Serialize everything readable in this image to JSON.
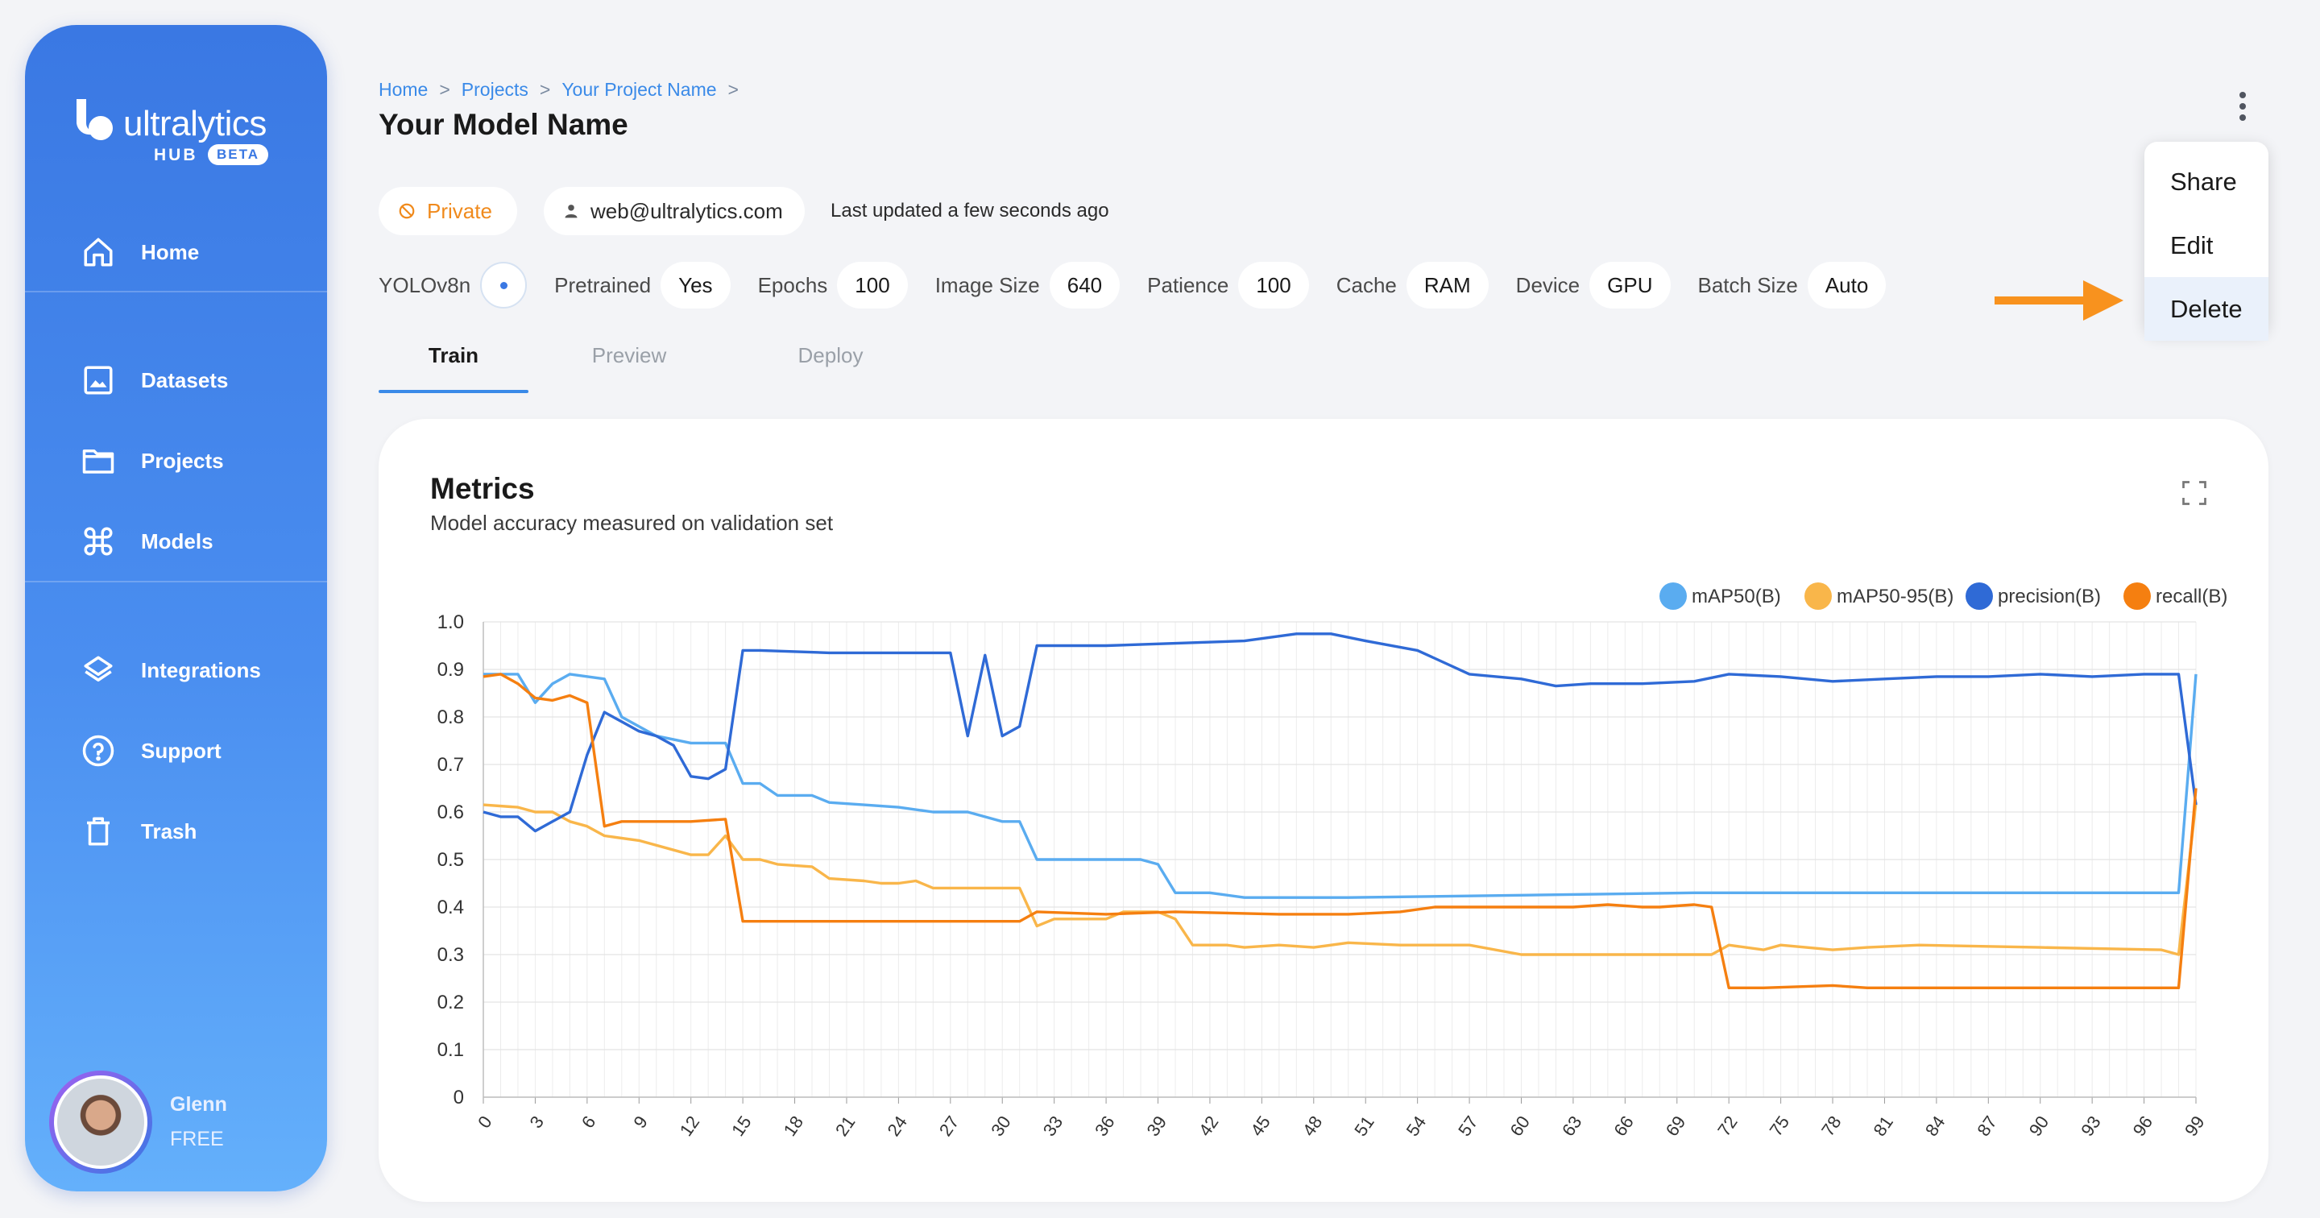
{
  "brand": {
    "name": "ultralytics",
    "hub": "HUB",
    "badge": "BETA"
  },
  "sidebar": {
    "items": [
      {
        "label": "Home",
        "icon": "home-icon"
      },
      {
        "label": "Datasets",
        "icon": "image-icon"
      },
      {
        "label": "Projects",
        "icon": "folder-icon"
      },
      {
        "label": "Models",
        "icon": "command-icon"
      },
      {
        "label": "Integrations",
        "icon": "layers-icon"
      },
      {
        "label": "Support",
        "icon": "help-icon"
      },
      {
        "label": "Trash",
        "icon": "trash-icon"
      }
    ],
    "user": {
      "name": "Glenn",
      "plan": "FREE"
    }
  },
  "breadcrumb": {
    "items": [
      "Home",
      "Projects",
      "Your Project Name"
    ],
    "separator": ">"
  },
  "page_title": "Your Model Name",
  "menu": {
    "items": [
      "Share",
      "Edit",
      "Delete"
    ],
    "highlighted": "Delete"
  },
  "chips": {
    "visibility": "Private",
    "owner": "web@ultralytics.com",
    "last_updated": "Last updated a few seconds ago"
  },
  "params": {
    "model": "YOLOv8n",
    "pretrained_label": "Pretrained",
    "pretrained": "Yes",
    "epochs_label": "Epochs",
    "epochs": "100",
    "image_size_label": "Image Size",
    "image_size": "640",
    "patience_label": "Patience",
    "patience": "100",
    "cache_label": "Cache",
    "cache": "RAM",
    "device_label": "Device",
    "device": "GPU",
    "batch_size_label": "Batch Size",
    "batch_size": "Auto"
  },
  "tabs": [
    {
      "label": "Train",
      "active": true
    },
    {
      "label": "Preview",
      "active": false
    },
    {
      "label": "Deploy",
      "active": false
    }
  ],
  "card": {
    "title": "Metrics",
    "subtitle": "Model accuracy measured on validation set"
  },
  "colors": {
    "accent": "#3a78e3",
    "private": "#f08a1c",
    "map50": "#5aacf0",
    "map50_95": "#f9b64a",
    "precision": "#2f6ad6",
    "recall": "#f57f10",
    "arrow": "#f8921e"
  },
  "chart_data": {
    "type": "line",
    "title": "",
    "xlabel": "",
    "ylabel": "",
    "xlim": [
      0,
      99
    ],
    "ylim": [
      0,
      1.0
    ],
    "x_ticks": [
      0,
      3,
      6,
      9,
      12,
      15,
      18,
      21,
      24,
      27,
      30,
      33,
      36,
      39,
      42,
      45,
      48,
      51,
      54,
      57,
      60,
      63,
      66,
      69,
      72,
      75,
      78,
      81,
      84,
      87,
      90,
      93,
      96,
      99
    ],
    "y_ticks": [
      0,
      0.1,
      0.2,
      0.3,
      0.4,
      0.5,
      0.6,
      0.7,
      0.8,
      0.9,
      1.0
    ],
    "legend_position": "top-right",
    "grid": true,
    "series": [
      {
        "name": "mAP50(B)",
        "color": "#5aacf0",
        "points": [
          [
            0,
            0.89
          ],
          [
            2,
            0.89
          ],
          [
            3,
            0.83
          ],
          [
            4,
            0.87
          ],
          [
            5,
            0.89
          ],
          [
            7,
            0.88
          ],
          [
            8,
            0.8
          ],
          [
            10,
            0.76
          ],
          [
            12,
            0.745
          ],
          [
            14,
            0.745
          ],
          [
            15,
            0.66
          ],
          [
            16,
            0.66
          ],
          [
            17,
            0.635
          ],
          [
            19,
            0.635
          ],
          [
            20,
            0.62
          ],
          [
            22,
            0.615
          ],
          [
            24,
            0.61
          ],
          [
            26,
            0.6
          ],
          [
            28,
            0.6
          ],
          [
            30,
            0.58
          ],
          [
            31,
            0.58
          ],
          [
            32,
            0.5
          ],
          [
            34,
            0.5
          ],
          [
            36,
            0.5
          ],
          [
            38,
            0.5
          ],
          [
            39,
            0.49
          ],
          [
            40,
            0.43
          ],
          [
            42,
            0.43
          ],
          [
            44,
            0.42
          ],
          [
            50,
            0.42
          ],
          [
            60,
            0.425
          ],
          [
            70,
            0.43
          ],
          [
            80,
            0.43
          ],
          [
            90,
            0.43
          ],
          [
            97,
            0.43
          ],
          [
            98,
            0.43
          ],
          [
            99,
            0.89
          ]
        ]
      },
      {
        "name": "mAP50-95(B)",
        "color": "#f9b64a",
        "points": [
          [
            0,
            0.615
          ],
          [
            2,
            0.61
          ],
          [
            3,
            0.6
          ],
          [
            4,
            0.6
          ],
          [
            5,
            0.58
          ],
          [
            6,
            0.57
          ],
          [
            7,
            0.55
          ],
          [
            9,
            0.54
          ],
          [
            11,
            0.52
          ],
          [
            12,
            0.51
          ],
          [
            13,
            0.51
          ],
          [
            14,
            0.55
          ],
          [
            15,
            0.5
          ],
          [
            16,
            0.5
          ],
          [
            17,
            0.49
          ],
          [
            19,
            0.485
          ],
          [
            20,
            0.46
          ],
          [
            22,
            0.455
          ],
          [
            23,
            0.45
          ],
          [
            24,
            0.45
          ],
          [
            25,
            0.455
          ],
          [
            26,
            0.44
          ],
          [
            28,
            0.44
          ],
          [
            30,
            0.44
          ],
          [
            31,
            0.44
          ],
          [
            32,
            0.36
          ],
          [
            33,
            0.375
          ],
          [
            36,
            0.375
          ],
          [
            37,
            0.39
          ],
          [
            39,
            0.39
          ],
          [
            40,
            0.375
          ],
          [
            41,
            0.32
          ],
          [
            43,
            0.32
          ],
          [
            44,
            0.315
          ],
          [
            46,
            0.32
          ],
          [
            48,
            0.315
          ],
          [
            50,
            0.325
          ],
          [
            53,
            0.32
          ],
          [
            57,
            0.32
          ],
          [
            60,
            0.3
          ],
          [
            63,
            0.3
          ],
          [
            70,
            0.3
          ],
          [
            71,
            0.3
          ],
          [
            72,
            0.32
          ],
          [
            74,
            0.31
          ],
          [
            75,
            0.32
          ],
          [
            78,
            0.31
          ],
          [
            80,
            0.315
          ],
          [
            83,
            0.32
          ],
          [
            90,
            0.315
          ],
          [
            97,
            0.31
          ],
          [
            98,
            0.3
          ],
          [
            99,
            0.62
          ]
        ]
      },
      {
        "name": "precision(B)",
        "color": "#2f6ad6",
        "points": [
          [
            0,
            0.6
          ],
          [
            1,
            0.59
          ],
          [
            2,
            0.59
          ],
          [
            3,
            0.56
          ],
          [
            4,
            0.58
          ],
          [
            5,
            0.6
          ],
          [
            6,
            0.72
          ],
          [
            7,
            0.81
          ],
          [
            8,
            0.79
          ],
          [
            9,
            0.77
          ],
          [
            10,
            0.76
          ],
          [
            11,
            0.74
          ],
          [
            12,
            0.675
          ],
          [
            13,
            0.67
          ],
          [
            14,
            0.69
          ],
          [
            15,
            0.94
          ],
          [
            16,
            0.94
          ],
          [
            20,
            0.935
          ],
          [
            24,
            0.935
          ],
          [
            27,
            0.935
          ],
          [
            28,
            0.76
          ],
          [
            29,
            0.93
          ],
          [
            30,
            0.76
          ],
          [
            31,
            0.78
          ],
          [
            32,
            0.95
          ],
          [
            36,
            0.95
          ],
          [
            40,
            0.955
          ],
          [
            44,
            0.96
          ],
          [
            47,
            0.975
          ],
          [
            49,
            0.975
          ],
          [
            51,
            0.96
          ],
          [
            54,
            0.94
          ],
          [
            57,
            0.89
          ],
          [
            60,
            0.88
          ],
          [
            62,
            0.865
          ],
          [
            64,
            0.87
          ],
          [
            67,
            0.87
          ],
          [
            70,
            0.875
          ],
          [
            72,
            0.89
          ],
          [
            75,
            0.885
          ],
          [
            78,
            0.875
          ],
          [
            81,
            0.88
          ],
          [
            84,
            0.885
          ],
          [
            87,
            0.885
          ],
          [
            90,
            0.89
          ],
          [
            93,
            0.885
          ],
          [
            96,
            0.89
          ],
          [
            97,
            0.89
          ],
          [
            98,
            0.89
          ],
          [
            99,
            0.615
          ]
        ]
      },
      {
        "name": "recall(B)",
        "color": "#f57f10",
        "points": [
          [
            0,
            0.885
          ],
          [
            1,
            0.89
          ],
          [
            2,
            0.87
          ],
          [
            3,
            0.84
          ],
          [
            4,
            0.835
          ],
          [
            5,
            0.845
          ],
          [
            6,
            0.83
          ],
          [
            7,
            0.57
          ],
          [
            8,
            0.58
          ],
          [
            10,
            0.58
          ],
          [
            12,
            0.58
          ],
          [
            14,
            0.585
          ],
          [
            15,
            0.37
          ],
          [
            18,
            0.37
          ],
          [
            20,
            0.37
          ],
          [
            24,
            0.37
          ],
          [
            28,
            0.37
          ],
          [
            31,
            0.37
          ],
          [
            32,
            0.39
          ],
          [
            36,
            0.385
          ],
          [
            40,
            0.39
          ],
          [
            46,
            0.385
          ],
          [
            50,
            0.385
          ],
          [
            53,
            0.39
          ],
          [
            55,
            0.4
          ],
          [
            58,
            0.4
          ],
          [
            63,
            0.4
          ],
          [
            65,
            0.405
          ],
          [
            67,
            0.4
          ],
          [
            68,
            0.4
          ],
          [
            70,
            0.405
          ],
          [
            71,
            0.4
          ],
          [
            72,
            0.23
          ],
          [
            74,
            0.23
          ],
          [
            78,
            0.235
          ],
          [
            80,
            0.23
          ],
          [
            90,
            0.23
          ],
          [
            97,
            0.23
          ],
          [
            98,
            0.23
          ],
          [
            99,
            0.65
          ]
        ]
      }
    ]
  }
}
